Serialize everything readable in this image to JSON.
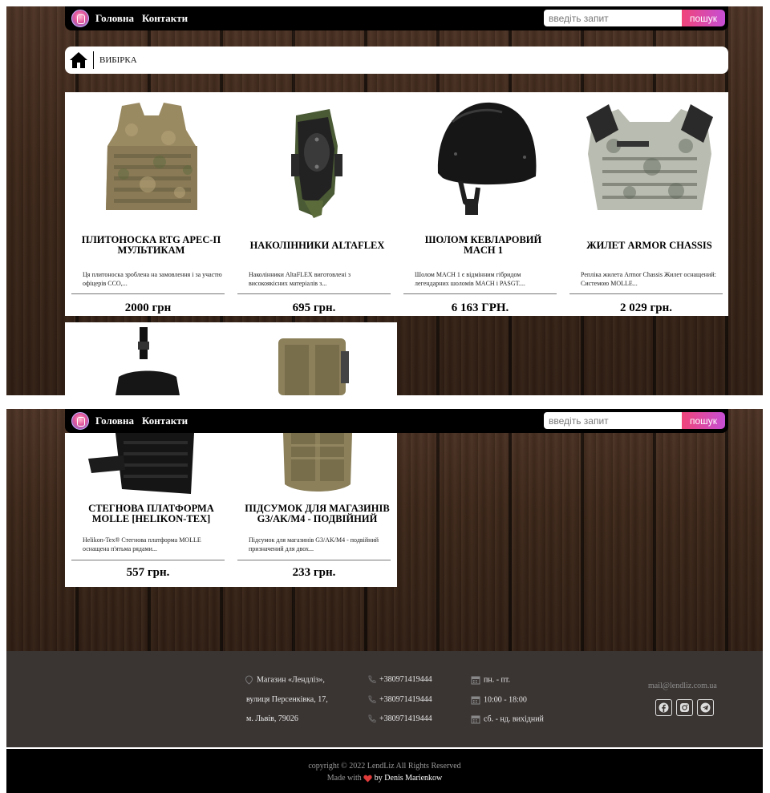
{
  "nav": {
    "home": "Головна",
    "contacts": "Контакти"
  },
  "search": {
    "placeholder": "введіть запит",
    "button": "пошук"
  },
  "breadcrumb": {
    "current": "ВИБІРКА"
  },
  "products": [
    {
      "title": "ПЛИТОНОСКА RTG APEC-П МУЛЬТИКАМ",
      "desc": "Ця плитоноска зроблена на замовлення і за участю офіцерів ССО,...",
      "price": "2000 грн"
    },
    {
      "title": "НАКОЛІННИКИ ALTAFLEX",
      "desc": "Наколінники AltaFLEX виготовлені з високоякісних матеріалів з...",
      "price": "695 грн."
    },
    {
      "title": "ШОЛОМ КЕВЛАРОВИЙ MACH 1",
      "desc": "Шолом MACH 1 є відмінним гібридом легендарних шоломів MACH і PASGT....",
      "price": "6 163 ГРН."
    },
    {
      "title": "ЖИЛЕТ ARMOR CHASSIS",
      "desc": "Репліка жилета Armor Chassis Жилет оснащений: Системою MOLLE...",
      "price": "2 029 грн."
    },
    {
      "title": "СТЕГНОВА ПЛАТФОРМА MOLLE [HELIKON-TEX]",
      "desc": "Helikon-Tex® Стегнова платформа MOLLE оснащена п'ятьма рядами...",
      "price": "557 грн."
    },
    {
      "title": "ПІДСУМОК ДЛЯ МАГАЗИНІВ G3/AK/M4 - ПОДВІЙНИЙ",
      "desc": "Підсумок для магазинів G3/AK/M4 - подвійний призначений для двох...",
      "price": "233 грн."
    }
  ],
  "footer": {
    "address": [
      "Магазин «Лендліз»,",
      "вулиця Персенківка, 17,",
      "м. Львів, 79026"
    ],
    "phones": [
      "+380971419444",
      "+380971419444",
      "+380971419444"
    ],
    "hours": [
      "пн. - пт.",
      "10:00 - 18:00",
      "сб. - нд. вихідний"
    ],
    "email": "mail@lendliz.com.ua",
    "copyright": "copyright © 2022 LendLiz All Rights Reserved",
    "made_with": "Made with",
    "author": "by Denis Marienkow"
  }
}
